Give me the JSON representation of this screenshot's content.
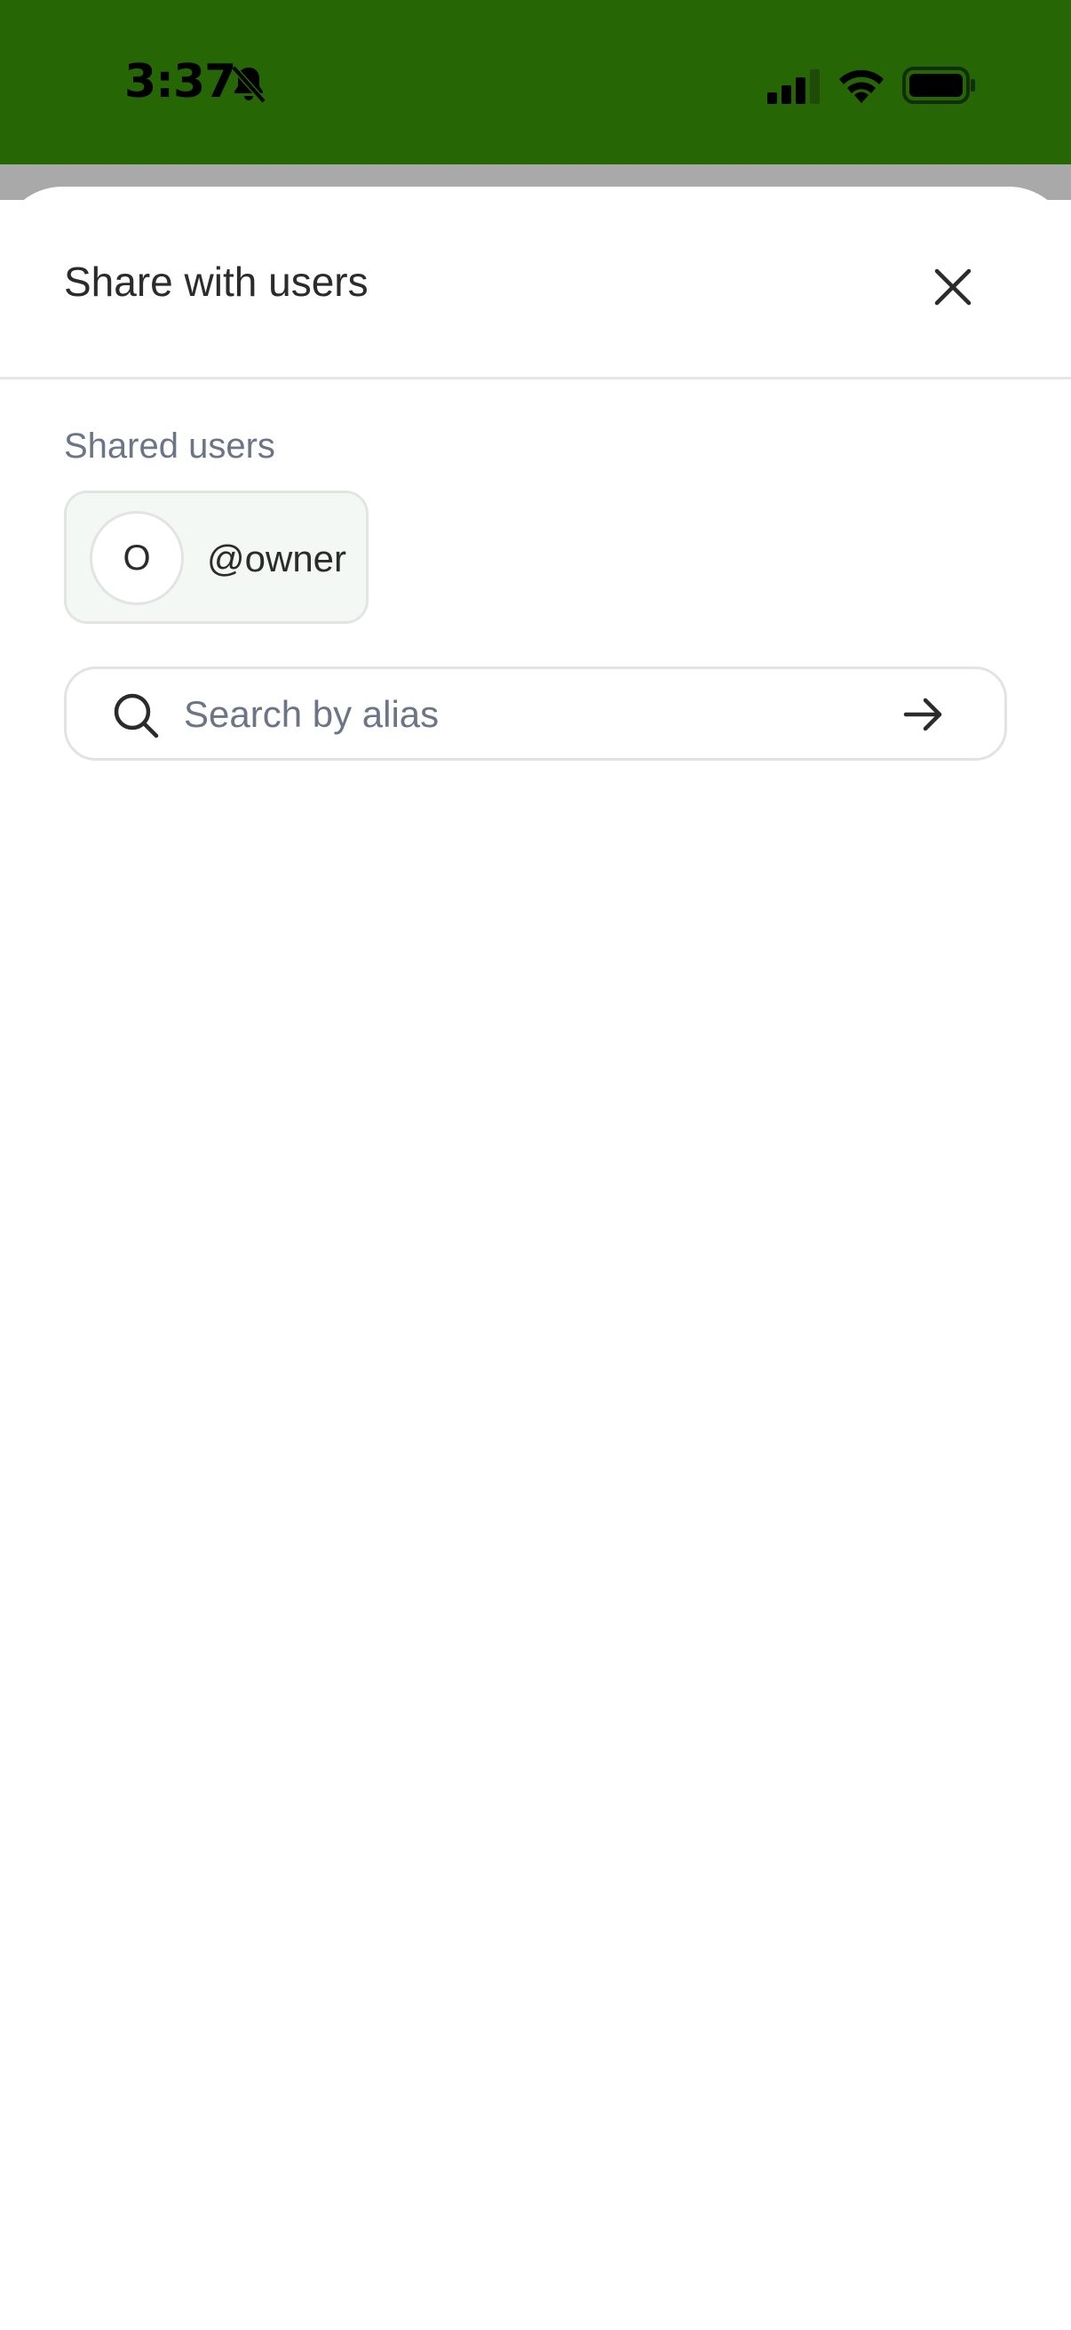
{
  "status_bar": {
    "time": "3:37",
    "background_color": "#266604",
    "icons": [
      "bell-slash-icon",
      "cellular-signal-icon",
      "wifi-icon",
      "battery-icon"
    ]
  },
  "sheet": {
    "title": "Share with users",
    "close_icon": "close-icon"
  },
  "shared_users": {
    "label": "Shared users",
    "users": [
      {
        "initial": "O",
        "alias": "@owner"
      }
    ]
  },
  "search": {
    "placeholder": "Search by alias",
    "value": "",
    "leading_icon": "search-icon",
    "submit_icon": "arrow-right-icon"
  }
}
